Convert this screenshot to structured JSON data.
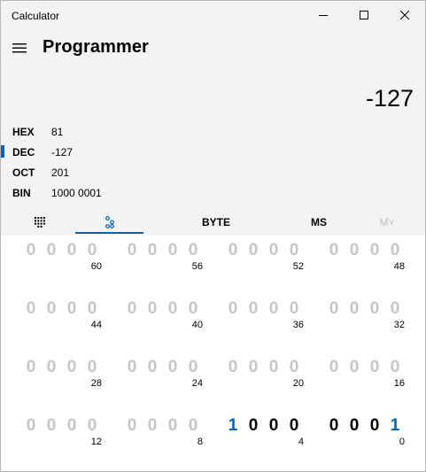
{
  "window": {
    "title": "Calculator",
    "minimize_icon": "minimize-icon",
    "maximize_icon": "maximize-icon",
    "close_icon": "close-icon"
  },
  "header": {
    "menu_icon": "hamburger-icon",
    "mode": "Programmer"
  },
  "display": {
    "value": "-127"
  },
  "radix": [
    {
      "label": "HEX",
      "value": "81",
      "selected": false
    },
    {
      "label": "DEC",
      "value": "-127",
      "selected": true
    },
    {
      "label": "OCT",
      "value": "201",
      "selected": false
    },
    {
      "label": "BIN",
      "value": "1000 0001",
      "selected": false
    }
  ],
  "tabs": {
    "full_keypad_icon": "keypad-grid-icon",
    "bit_toggle_icon": "bit-toggle-icon",
    "active": "bit-toggle"
  },
  "toolbar": {
    "word_size": "BYTE",
    "ms": "MS",
    "mv": "M˅"
  },
  "bits": {
    "rows": [
      {
        "groups": [
          {
            "digits": [
              "0",
              "0",
              "0",
              "0"
            ],
            "position": "60",
            "active": false
          },
          {
            "digits": [
              "0",
              "0",
              "0",
              "0"
            ],
            "position": "56",
            "active": false
          },
          {
            "digits": [
              "0",
              "0",
              "0",
              "0"
            ],
            "position": "52",
            "active": false
          },
          {
            "digits": [
              "0",
              "0",
              "0",
              "0"
            ],
            "position": "48",
            "active": false
          }
        ]
      },
      {
        "groups": [
          {
            "digits": [
              "0",
              "0",
              "0",
              "0"
            ],
            "position": "44",
            "active": false
          },
          {
            "digits": [
              "0",
              "0",
              "0",
              "0"
            ],
            "position": "40",
            "active": false
          },
          {
            "digits": [
              "0",
              "0",
              "0",
              "0"
            ],
            "position": "36",
            "active": false
          },
          {
            "digits": [
              "0",
              "0",
              "0",
              "0"
            ],
            "position": "32",
            "active": false
          }
        ]
      },
      {
        "groups": [
          {
            "digits": [
              "0",
              "0",
              "0",
              "0"
            ],
            "position": "28",
            "active": false
          },
          {
            "digits": [
              "0",
              "0",
              "0",
              "0"
            ],
            "position": "24",
            "active": false
          },
          {
            "digits": [
              "0",
              "0",
              "0",
              "0"
            ],
            "position": "20",
            "active": false
          },
          {
            "digits": [
              "0",
              "0",
              "0",
              "0"
            ],
            "position": "16",
            "active": false
          }
        ]
      },
      {
        "groups": [
          {
            "digits": [
              "0",
              "0",
              "0",
              "0"
            ],
            "position": "12",
            "active": false
          },
          {
            "digits": [
              "0",
              "0",
              "0",
              "0"
            ],
            "position": "8",
            "active": false
          },
          {
            "digits": [
              "1",
              "0",
              "0",
              "0"
            ],
            "position": "4",
            "active": true
          },
          {
            "digits": [
              "0",
              "0",
              "0",
              "1"
            ],
            "position": "0",
            "active": true
          }
        ]
      }
    ]
  },
  "colors": {
    "accent": "#0063b1",
    "inactive_bit": "#c6c6c6",
    "background": "#f3f3f3",
    "bit_panel": "#ffffff"
  }
}
